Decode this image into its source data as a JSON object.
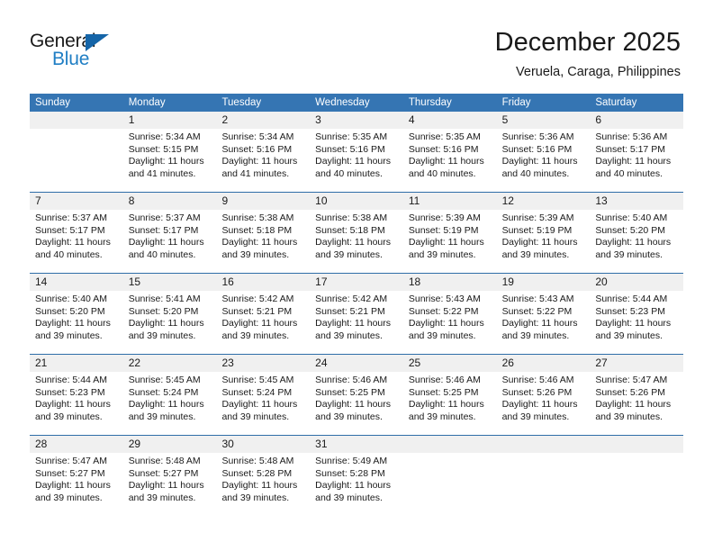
{
  "brand": {
    "name_top": "General",
    "name_bottom": "Blue",
    "triangle_icon": "triangle-icon",
    "blue_hex": "#1f7ec4",
    "dark_blue_hex": "#1565a8"
  },
  "header": {
    "title": "December 2025",
    "subtitle": "Veruela, Caraga, Philippines"
  },
  "theme": {
    "header_blue": "#3575b3",
    "separator_blue": "#2f6ea8",
    "date_strip_grey": "#f0f0f0"
  },
  "calendar": {
    "weekday_headers": [
      "Sunday",
      "Monday",
      "Tuesday",
      "Wednesday",
      "Thursday",
      "Friday",
      "Saturday"
    ],
    "weeks": [
      [
        {
          "day": "",
          "sunrise": "",
          "sunset": "",
          "daylight": ""
        },
        {
          "day": "1",
          "sunrise": "Sunrise: 5:34 AM",
          "sunset": "Sunset: 5:15 PM",
          "daylight": "Daylight: 11 hours and 41 minutes."
        },
        {
          "day": "2",
          "sunrise": "Sunrise: 5:34 AM",
          "sunset": "Sunset: 5:16 PM",
          "daylight": "Daylight: 11 hours and 41 minutes."
        },
        {
          "day": "3",
          "sunrise": "Sunrise: 5:35 AM",
          "sunset": "Sunset: 5:16 PM",
          "daylight": "Daylight: 11 hours and 40 minutes."
        },
        {
          "day": "4",
          "sunrise": "Sunrise: 5:35 AM",
          "sunset": "Sunset: 5:16 PM",
          "daylight": "Daylight: 11 hours and 40 minutes."
        },
        {
          "day": "5",
          "sunrise": "Sunrise: 5:36 AM",
          "sunset": "Sunset: 5:16 PM",
          "daylight": "Daylight: 11 hours and 40 minutes."
        },
        {
          "day": "6",
          "sunrise": "Sunrise: 5:36 AM",
          "sunset": "Sunset: 5:17 PM",
          "daylight": "Daylight: 11 hours and 40 minutes."
        }
      ],
      [
        {
          "day": "7",
          "sunrise": "Sunrise: 5:37 AM",
          "sunset": "Sunset: 5:17 PM",
          "daylight": "Daylight: 11 hours and 40 minutes."
        },
        {
          "day": "8",
          "sunrise": "Sunrise: 5:37 AM",
          "sunset": "Sunset: 5:17 PM",
          "daylight": "Daylight: 11 hours and 40 minutes."
        },
        {
          "day": "9",
          "sunrise": "Sunrise: 5:38 AM",
          "sunset": "Sunset: 5:18 PM",
          "daylight": "Daylight: 11 hours and 39 minutes."
        },
        {
          "day": "10",
          "sunrise": "Sunrise: 5:38 AM",
          "sunset": "Sunset: 5:18 PM",
          "daylight": "Daylight: 11 hours and 39 minutes."
        },
        {
          "day": "11",
          "sunrise": "Sunrise: 5:39 AM",
          "sunset": "Sunset: 5:19 PM",
          "daylight": "Daylight: 11 hours and 39 minutes."
        },
        {
          "day": "12",
          "sunrise": "Sunrise: 5:39 AM",
          "sunset": "Sunset: 5:19 PM",
          "daylight": "Daylight: 11 hours and 39 minutes."
        },
        {
          "day": "13",
          "sunrise": "Sunrise: 5:40 AM",
          "sunset": "Sunset: 5:20 PM",
          "daylight": "Daylight: 11 hours and 39 minutes."
        }
      ],
      [
        {
          "day": "14",
          "sunrise": "Sunrise: 5:40 AM",
          "sunset": "Sunset: 5:20 PM",
          "daylight": "Daylight: 11 hours and 39 minutes."
        },
        {
          "day": "15",
          "sunrise": "Sunrise: 5:41 AM",
          "sunset": "Sunset: 5:20 PM",
          "daylight": "Daylight: 11 hours and 39 minutes."
        },
        {
          "day": "16",
          "sunrise": "Sunrise: 5:42 AM",
          "sunset": "Sunset: 5:21 PM",
          "daylight": "Daylight: 11 hours and 39 minutes."
        },
        {
          "day": "17",
          "sunrise": "Sunrise: 5:42 AM",
          "sunset": "Sunset: 5:21 PM",
          "daylight": "Daylight: 11 hours and 39 minutes."
        },
        {
          "day": "18",
          "sunrise": "Sunrise: 5:43 AM",
          "sunset": "Sunset: 5:22 PM",
          "daylight": "Daylight: 11 hours and 39 minutes."
        },
        {
          "day": "19",
          "sunrise": "Sunrise: 5:43 AM",
          "sunset": "Sunset: 5:22 PM",
          "daylight": "Daylight: 11 hours and 39 minutes."
        },
        {
          "day": "20",
          "sunrise": "Sunrise: 5:44 AM",
          "sunset": "Sunset: 5:23 PM",
          "daylight": "Daylight: 11 hours and 39 minutes."
        }
      ],
      [
        {
          "day": "21",
          "sunrise": "Sunrise: 5:44 AM",
          "sunset": "Sunset: 5:23 PM",
          "daylight": "Daylight: 11 hours and 39 minutes."
        },
        {
          "day": "22",
          "sunrise": "Sunrise: 5:45 AM",
          "sunset": "Sunset: 5:24 PM",
          "daylight": "Daylight: 11 hours and 39 minutes."
        },
        {
          "day": "23",
          "sunrise": "Sunrise: 5:45 AM",
          "sunset": "Sunset: 5:24 PM",
          "daylight": "Daylight: 11 hours and 39 minutes."
        },
        {
          "day": "24",
          "sunrise": "Sunrise: 5:46 AM",
          "sunset": "Sunset: 5:25 PM",
          "daylight": "Daylight: 11 hours and 39 minutes."
        },
        {
          "day": "25",
          "sunrise": "Sunrise: 5:46 AM",
          "sunset": "Sunset: 5:25 PM",
          "daylight": "Daylight: 11 hours and 39 minutes."
        },
        {
          "day": "26",
          "sunrise": "Sunrise: 5:46 AM",
          "sunset": "Sunset: 5:26 PM",
          "daylight": "Daylight: 11 hours and 39 minutes."
        },
        {
          "day": "27",
          "sunrise": "Sunrise: 5:47 AM",
          "sunset": "Sunset: 5:26 PM",
          "daylight": "Daylight: 11 hours and 39 minutes."
        }
      ],
      [
        {
          "day": "28",
          "sunrise": "Sunrise: 5:47 AM",
          "sunset": "Sunset: 5:27 PM",
          "daylight": "Daylight: 11 hours and 39 minutes."
        },
        {
          "day": "29",
          "sunrise": "Sunrise: 5:48 AM",
          "sunset": "Sunset: 5:27 PM",
          "daylight": "Daylight: 11 hours and 39 minutes."
        },
        {
          "day": "30",
          "sunrise": "Sunrise: 5:48 AM",
          "sunset": "Sunset: 5:28 PM",
          "daylight": "Daylight: 11 hours and 39 minutes."
        },
        {
          "day": "31",
          "sunrise": "Sunrise: 5:49 AM",
          "sunset": "Sunset: 5:28 PM",
          "daylight": "Daylight: 11 hours and 39 minutes."
        },
        {
          "day": "",
          "sunrise": "",
          "sunset": "",
          "daylight": ""
        },
        {
          "day": "",
          "sunrise": "",
          "sunset": "",
          "daylight": ""
        },
        {
          "day": "",
          "sunrise": "",
          "sunset": "",
          "daylight": ""
        }
      ]
    ]
  }
}
